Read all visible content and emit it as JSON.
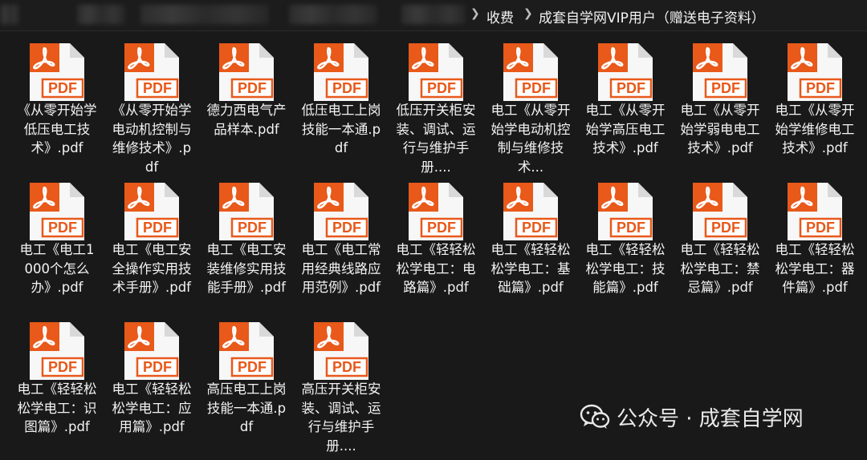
{
  "breadcrumb": {
    "items": [
      "收费",
      "成套自学网VIP用户（赠送电子资料）"
    ]
  },
  "file_icon": {
    "badge_text": "PDF",
    "icon": "pdf-file-icon",
    "accent": "#e8591a"
  },
  "files": [
    "《从零开始学低压电工技术》.pdf",
    "《从零开始学电动机控制与维修技术》.pdf",
    "德力西电气产品样本.pdf",
    "低压电工上岗技能一本通.pdf",
    "低压开关柜安装、调试、运行与维护手册....",
    "电工《从零开始学电动机控制与维修技术...",
    "电工《从零开始学高压电工技术》.pdf",
    "电工《从零开始学弱电电工技术》.pdf",
    "电工《从零开始学维修电工技术》.pdf",
    "电工《电工1000个怎么办》.pdf",
    "电工《电工安全操作实用技术手册》.pdf",
    "电工《电工安装维修实用技能手册》.pdf",
    "电工《电工常用经典线路应用范例》.pdf",
    "电工《轻轻松松学电工：电路篇》.pdf",
    "电工《轻轻松松学电工：基础篇》.pdf",
    "电工《轻轻松松学电工：技能篇》.pdf",
    "电工《轻轻松松学电工：禁忌篇》.pdf",
    "电工《轻轻松松学电工：器件篇》.pdf",
    "电工《轻轻松松学电工：识图篇》.pdf",
    "电工《轻轻松松学电工：应用篇》.pdf",
    "高压电工上岗技能一本通.pdf",
    "高压开关柜安装、调试、运行与维护手册...."
  ],
  "watermark": {
    "text": "公众号 · 成套自学网",
    "icon": "wechat-icon"
  }
}
